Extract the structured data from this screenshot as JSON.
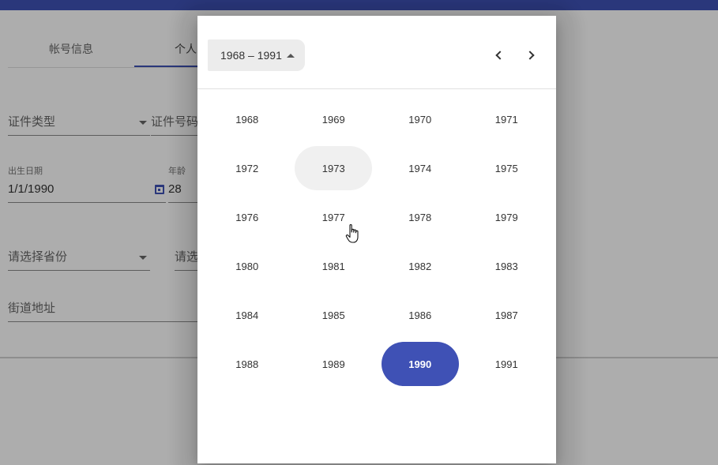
{
  "form": {
    "tabs": [
      {
        "label": "帐号信息"
      },
      {
        "label": "个人"
      }
    ],
    "id_type": {
      "placeholder": "证件类型"
    },
    "id_number": {
      "placeholder": "证件号码"
    },
    "birth_date": {
      "label": "出生日期",
      "value": "1/1/1990"
    },
    "age": {
      "label": "年龄",
      "value": "28"
    },
    "province": {
      "placeholder": "请选择省份"
    },
    "city": {
      "placeholder": "请选"
    },
    "street": {
      "placeholder": "街道地址"
    }
  },
  "datepicker": {
    "period_label": "1968 – 1991",
    "prev_icon": "chevron-left-icon",
    "next_icon": "chevron-right-icon",
    "years": [
      "1968",
      "1969",
      "1970",
      "1971",
      "1972",
      "1973",
      "1974",
      "1975",
      "1976",
      "1977",
      "1978",
      "1979",
      "1980",
      "1981",
      "1982",
      "1983",
      "1984",
      "1985",
      "1986",
      "1987",
      "1988",
      "1989",
      "1990",
      "1991"
    ],
    "selected_year": "1990",
    "hovered_year": "1973"
  },
  "colors": {
    "primary": "#3f51b5",
    "hover": "#f0f0f0"
  }
}
